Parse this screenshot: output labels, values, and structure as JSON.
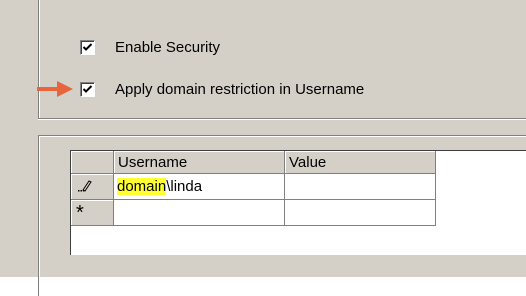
{
  "security": {
    "enable_label": "Enable Security",
    "enable_checked": true,
    "domain_restriction_label": "Apply domain restriction in Username",
    "domain_restriction_checked": true
  },
  "grid": {
    "columns": [
      "Username",
      "Value"
    ],
    "rows": [
      {
        "indicator": "pencil-icon",
        "username_prefix": "domain",
        "username_suffix": "\\linda",
        "value": ""
      },
      {
        "indicator": "asterisk-icon",
        "indicator_text": "*",
        "username": "",
        "value": ""
      }
    ]
  },
  "colors": {
    "arrow": "#e8643c",
    "highlight": "#ffff33",
    "panel": "#d4d0c8"
  }
}
